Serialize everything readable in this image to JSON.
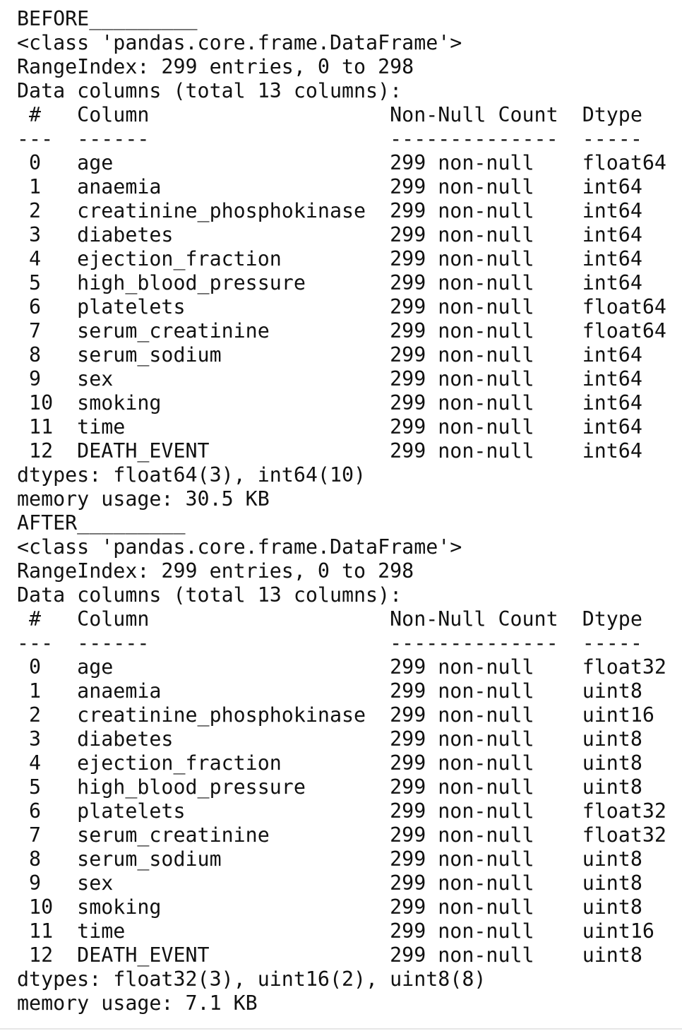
{
  "before": {
    "heading": "BEFORE_________",
    "class_line": "<class 'pandas.core.frame.DataFrame'>",
    "range_index": "RangeIndex: 299 entries, 0 to 298",
    "data_columns": "Data columns (total 13 columns):",
    "header": " #   Column                    Non-Null Count  Dtype  ",
    "separator": "---  ------                    --------------  -----  ",
    "rows": [
      " 0   age                       299 non-null    float64",
      " 1   anaemia                   299 non-null    int64  ",
      " 2   creatinine_phosphokinase  299 non-null    int64  ",
      " 3   diabetes                  299 non-null    int64  ",
      " 4   ejection_fraction         299 non-null    int64  ",
      " 5   high_blood_pressure       299 non-null    int64  ",
      " 6   platelets                 299 non-null    float64",
      " 7   serum_creatinine          299 non-null    float64",
      " 8   serum_sodium              299 non-null    int64  ",
      " 9   sex                       299 non-null    int64  ",
      " 10  smoking                   299 non-null    int64  ",
      " 11  time                      299 non-null    int64  ",
      " 12  DEATH_EVENT               299 non-null    int64  "
    ],
    "dtypes": "dtypes: float64(3), int64(10)",
    "memory": "memory usage: 30.5 KB"
  },
  "after": {
    "heading": "AFTER_________",
    "class_line": "<class 'pandas.core.frame.DataFrame'>",
    "range_index": "RangeIndex: 299 entries, 0 to 298",
    "data_columns": "Data columns (total 13 columns):",
    "header": " #   Column                    Non-Null Count  Dtype  ",
    "separator": "---  ------                    --------------  -----  ",
    "rows": [
      " 0   age                       299 non-null    float32",
      " 1   anaemia                   299 non-null    uint8  ",
      " 2   creatinine_phosphokinase  299 non-null    uint16 ",
      " 3   diabetes                  299 non-null    uint8  ",
      " 4   ejection_fraction         299 non-null    uint8  ",
      " 5   high_blood_pressure       299 non-null    uint8  ",
      " 6   platelets                 299 non-null    float32",
      " 7   serum_creatinine          299 non-null    float32",
      " 8   serum_sodium              299 non-null    uint8  ",
      " 9   sex                       299 non-null    uint8  ",
      " 10  smoking                   299 non-null    uint8  ",
      " 11  time                      299 non-null    uint16 ",
      " 12  DEATH_EVENT               299 non-null    uint8  "
    ],
    "dtypes": "dtypes: float32(3), uint16(2), uint8(8)",
    "memory": "memory usage: 7.1 KB"
  }
}
